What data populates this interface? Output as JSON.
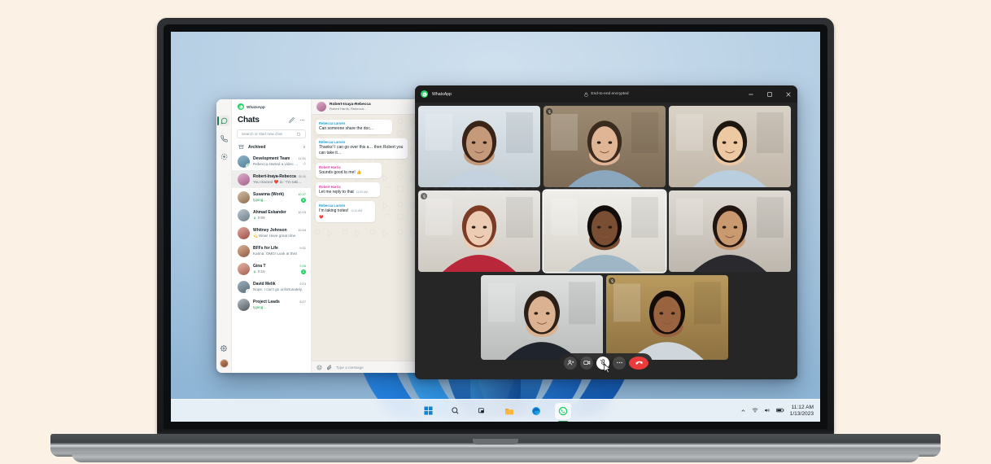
{
  "theme": {
    "page_bg": "#fbf1e4",
    "accent_green": "#25d366",
    "whatsapp_dark": "#1c1c1c",
    "end_call_red": "#ea3a3a",
    "author_blue": "#1f9ed8",
    "author_pink": "#e542a3"
  },
  "taskbar": {
    "items": [
      {
        "name": "start-button",
        "icon": "windows-start-icon"
      },
      {
        "name": "search-button",
        "icon": "search-icon"
      },
      {
        "name": "task-view-button",
        "icon": "task-view-icon"
      },
      {
        "name": "file-explorer-button",
        "icon": "folder-icon"
      },
      {
        "name": "edge-button",
        "icon": "edge-icon"
      },
      {
        "name": "whatsapp-button",
        "icon": "whatsapp-icon",
        "active": true
      }
    ],
    "tray": {
      "chevron": "show-hidden-icons",
      "network": "wifi-icon",
      "volume": "volume-icon",
      "battery": "battery-icon",
      "time": "11:12 AM",
      "date": "1/13/2023"
    }
  },
  "main_window": {
    "brand": "WhatsApp",
    "rail": [
      {
        "name": "chats",
        "icon": "chat-bubble-icon",
        "active": true
      },
      {
        "name": "calls",
        "icon": "phone-icon",
        "active": false
      },
      {
        "name": "status",
        "icon": "status-circle-icon",
        "active": false
      },
      {
        "name": "settings",
        "icon": "gear-icon",
        "active": false
      },
      {
        "name": "profile",
        "icon": "avatar-icon",
        "active": false
      }
    ],
    "list": {
      "title": "Chats",
      "new_chat_icon": "new-chat-icon",
      "more_icon": "more-horizontal-icon",
      "search_placeholder": "Search or start new chat",
      "search_icon": "search-icon",
      "archived_label": "Archived",
      "archived_count": "2",
      "archived_icon": "archive-box-icon",
      "chats": [
        {
          "name": "Development Team",
          "time": "11:01",
          "message": "Rebecca started a video call",
          "typing": false,
          "unread": "",
          "time_green": false,
          "pinned": true,
          "avatar_from": "#8fb6c9",
          "avatar_to": "#4f7f96",
          "badge": "call"
        },
        {
          "name": "Robert-Inaya-Rebecca",
          "time": "11:11",
          "message": "You reacted ❤️ to: “I’m taking n…",
          "typing": false,
          "unread": "",
          "time_green": false,
          "pinned": false,
          "selected": true,
          "avatar_from": "#e0aecb",
          "avatar_to": "#a4618c",
          "badge": ""
        },
        {
          "name": "Susanna (Work)",
          "time": "10:37",
          "message": "typing…",
          "typing": true,
          "unread": "3",
          "time_green": true,
          "pinned": false,
          "avatar_from": "#d7c1a6",
          "avatar_to": "#8b6a4b",
          "badge": ""
        },
        {
          "name": "Ahmad Eskander",
          "time": "10:15",
          "message": "0:09",
          "voice": true,
          "typing": false,
          "unread": "",
          "time_green": false,
          "pinned": false,
          "avatar_from": "#b9c6cf",
          "avatar_to": "#6d7f8c",
          "badge": ""
        },
        {
          "name": "Whitney Johnson",
          "time": "10:04",
          "message": "💫 Wow! Have great time.",
          "typing": false,
          "unread": "",
          "time_green": false,
          "pinned": false,
          "avatar_from": "#e2a8a0",
          "avatar_to": "#9c4f46",
          "badge": ""
        },
        {
          "name": "BFFs for Life",
          "time": "9:31",
          "message": "Karina: OMG! Look at this!",
          "typing": false,
          "unread": "",
          "time_green": false,
          "pinned": false,
          "avatar_from": "#dfb59a",
          "avatar_to": "#8d5a3c",
          "badge": ""
        },
        {
          "name": "Gina T",
          "time": "9:26",
          "message": "0:16",
          "voice": true,
          "typing": false,
          "unread": "1",
          "time_green": true,
          "pinned": false,
          "avatar_from": "#e7b6a8",
          "avatar_to": "#a2604f",
          "badge": ""
        },
        {
          "name": "David Melik",
          "time": "9:13",
          "message": "Nope. I can’t go unfortunately.",
          "typing": false,
          "unread": "",
          "time_green": false,
          "pinned": false,
          "avatar_from": "#9fb0bd",
          "avatar_to": "#5b6c79",
          "badge": "mute"
        },
        {
          "name": "Project Leads",
          "time": "8:27",
          "message": "typing…",
          "typing": true,
          "unread": "",
          "time_green": false,
          "pinned": false,
          "avatar_from": "#b7bfc6",
          "avatar_to": "#4e575f",
          "badge": ""
        }
      ]
    },
    "conversation": {
      "title": "Robert-Inaya-Rebecca",
      "subtitle": "Robert Harris, Rebecca…",
      "messages": [
        {
          "author": "Rebecca Larsen",
          "color": "#1f9ed8",
          "text": "Can someone share the doc…",
          "time": ""
        },
        {
          "author": "Rebecca Larsen",
          "color": "#1f9ed8",
          "text": "Thanks! I can go over this a… then Robert you can take it…",
          "time": ""
        },
        {
          "author": "Robert Harris",
          "color": "#e542a3",
          "text": "Sounds good to me! 👍",
          "time": ""
        },
        {
          "author": "Robert Harris",
          "color": "#e542a3",
          "text": "Let me reply to that",
          "time": "11:09 AM"
        },
        {
          "author": "Rebecca Larsen",
          "color": "#1f9ed8",
          "text": "I’m taking notes!",
          "time": "11:11 AM",
          "reaction": "❤️"
        }
      ],
      "composer_placeholder": "Type a message",
      "emoji_icon": "emoji-icon",
      "attach_icon": "paperclip-icon"
    }
  },
  "call_window": {
    "brand": "WhatsApp",
    "encryption_label": "End-to-end encrypted",
    "lock_icon": "lock-icon",
    "minimize_icon": "minimize-icon",
    "maximize_icon": "maximize-icon",
    "close_icon": "close-icon",
    "participants": [
      {
        "id": "p1",
        "muted": false,
        "speaking": false,
        "skin": "#c49a7a",
        "hair": "#3a2418",
        "shirt": "#c3d2de",
        "bg_top": "#dfe7ed",
        "bg_bottom": "#c3cdd4"
      },
      {
        "id": "p2",
        "muted": true,
        "speaking": false,
        "skin": "#e0b596",
        "hair": "#3b2a1e",
        "shirt": "#8aa7bd",
        "bg_top": "#9d8a72",
        "bg_bottom": "#7d6b56"
      },
      {
        "id": "p3",
        "muted": false,
        "speaking": false,
        "skin": "#ecc9a3",
        "hair": "#1d1712",
        "shirt": "#b9cfe0",
        "bg_top": "#d9d2c7",
        "bg_bottom": "#c0b6a8"
      },
      {
        "id": "p4",
        "muted": true,
        "speaking": false,
        "skin": "#eccdb3",
        "hair": "#7b3b25",
        "shirt": "#b8283a",
        "bg_top": "#e8e6e2",
        "bg_bottom": "#cfcac2"
      },
      {
        "id": "p5",
        "muted": false,
        "speaking": true,
        "skin": "#7a4e33",
        "hair": "#120d0a",
        "shirt": "#9fb6c6",
        "bg_top": "#efeee9",
        "bg_bottom": "#d6d3cb"
      },
      {
        "id": "p6",
        "muted": false,
        "speaking": false,
        "skin": "#c99a70",
        "hair": "#201511",
        "shirt": "#2a2a2e",
        "bg_top": "#ded9d2",
        "bg_bottom": "#bdb7ae"
      },
      {
        "id": "p7",
        "muted": false,
        "speaking": false,
        "skin": "#dcb392",
        "hair": "#2d2019",
        "shirt": "#20242c",
        "bg_top": "#dde0de",
        "bg_bottom": "#b9bcba"
      },
      {
        "id": "p8",
        "muted": true,
        "speaking": false,
        "skin": "#9a6340",
        "hair": "#130c09",
        "shirt": "#cfd6dc",
        "bg_top": "#b99a5e",
        "bg_bottom": "#8d7140"
      }
    ],
    "controls": [
      {
        "name": "add-participant-button",
        "icon": "add-person-icon",
        "state": "off"
      },
      {
        "name": "camera-button",
        "icon": "video-camera-icon",
        "state": "off"
      },
      {
        "name": "mute-button",
        "icon": "mic-muted-icon",
        "state": "on"
      },
      {
        "name": "more-options-button",
        "icon": "more-horizontal-icon",
        "state": "off"
      },
      {
        "name": "end-call-button",
        "icon": "end-call-icon",
        "state": "end"
      }
    ]
  }
}
